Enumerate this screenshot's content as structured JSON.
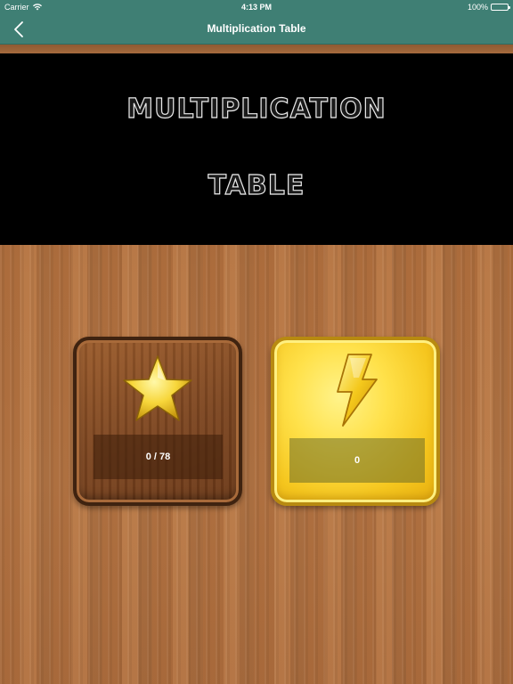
{
  "status_bar": {
    "carrier": "Carrier",
    "time": "4:13 PM",
    "battery": "100%"
  },
  "nav": {
    "title": "Multiplication Table",
    "back_icon": "chevron-left-icon"
  },
  "banner": {
    "line1": "MULTIPLICATION",
    "line2": "TABLE"
  },
  "cards": [
    {
      "icon": "star-icon",
      "label": "0 / 78"
    },
    {
      "icon": "lightning-icon",
      "label": "0"
    }
  ],
  "colors": {
    "nav_bar": "#3f7f74",
    "banner": "#000000",
    "wood": "#b57442",
    "gold": "#ffe14a"
  }
}
